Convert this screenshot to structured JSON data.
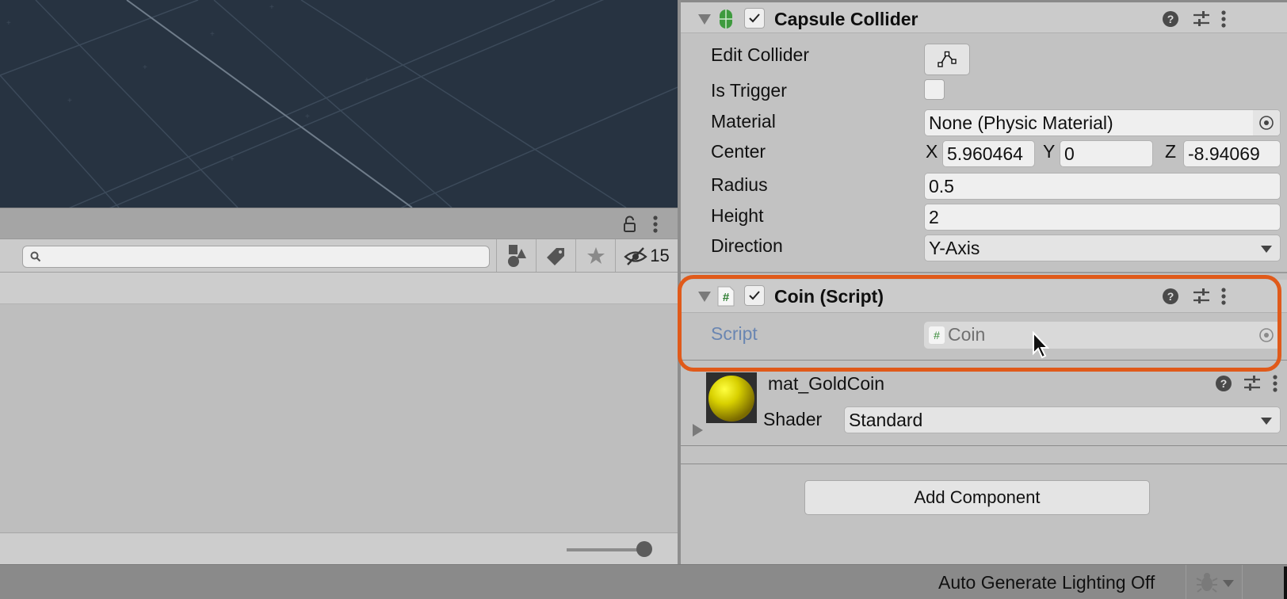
{
  "left_panel": {
    "search_placeholder": "",
    "hidden_count": "15",
    "zoom_slider_value_percent": 100
  },
  "inspector": {
    "capsule_collider": {
      "title": "Capsule Collider",
      "enabled": true,
      "edit_collider_label": "Edit Collider",
      "is_trigger_label": "Is Trigger",
      "is_trigger": false,
      "material_label": "Material",
      "material_value": "None (Physic Material)",
      "center_label": "Center",
      "center_x_label": "X",
      "center_x": "5.960464",
      "center_y_label": "Y",
      "center_y": "0",
      "center_z_label": "Z",
      "center_z": "-8.94069",
      "radius_label": "Radius",
      "radius": "0.5",
      "height_label": "Height",
      "height": "2",
      "direction_label": "Direction",
      "direction": "Y-Axis"
    },
    "coin_script": {
      "title": "Coin (Script)",
      "enabled": true,
      "script_label": "Script",
      "script_value": "Coin",
      "highlight_color": "#e05a1a"
    },
    "material": {
      "name": "mat_GoldCoin",
      "shader_label": "Shader",
      "shader_value": "Standard"
    },
    "add_component_label": "Add Component"
  },
  "statusbar": {
    "lighting_text": "Auto Generate Lighting Off"
  }
}
